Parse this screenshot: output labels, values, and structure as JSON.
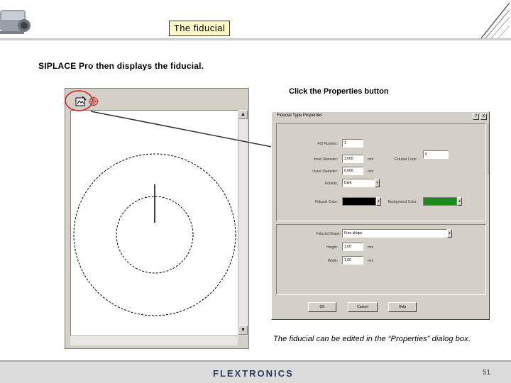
{
  "slide": {
    "title": "The fiducial",
    "intro": "SIPLACE Pro then displays the fiducial.",
    "instruction": "Click the Properties button",
    "caption": "The fiducial can be edited in the “Properties” dialog box.",
    "page_number": "51"
  },
  "footer": {
    "logo_text": "FLEXTRONICS"
  },
  "editor": {
    "toolbar_icons": [
      "properties-icon",
      "fiducial-icon"
    ],
    "highlight_color": "#cc2222"
  },
  "dialog": {
    "title": "Fiducial Type Properties",
    "help_label": "?",
    "close_label": "X",
    "fields": {
      "fid_number_label": "FID Number:",
      "fid_number_value": "1",
      "inner_diameter_label": "Inner Diameter:",
      "inner_diameter_value": "3,000",
      "inner_diameter_unit": "mm",
      "outer_diameter_label": "Outer Diameter:",
      "outer_diameter_value": "6,000",
      "outer_diameter_unit": "mm",
      "polarity_label": "Polarity:",
      "polarity_value": "Dark",
      "code_label": "Fiducial Code:",
      "code_value": "0",
      "fid_color_label": "Fiducial Color:",
      "bg_color_label": "Background Color:",
      "shape_label": "Fiducial Shape:",
      "shape_value": "Free shape",
      "height_label": "Height:",
      "height_value": "1,00",
      "height_unit": "mm",
      "width_label": "Width:",
      "width_value": "1,00",
      "width_unit": "mm"
    },
    "fid_color": "#000000",
    "bg_color": "#1a8a1a",
    "buttons": {
      "ok": "OK",
      "cancel": "Cancel",
      "help": "Help"
    }
  }
}
